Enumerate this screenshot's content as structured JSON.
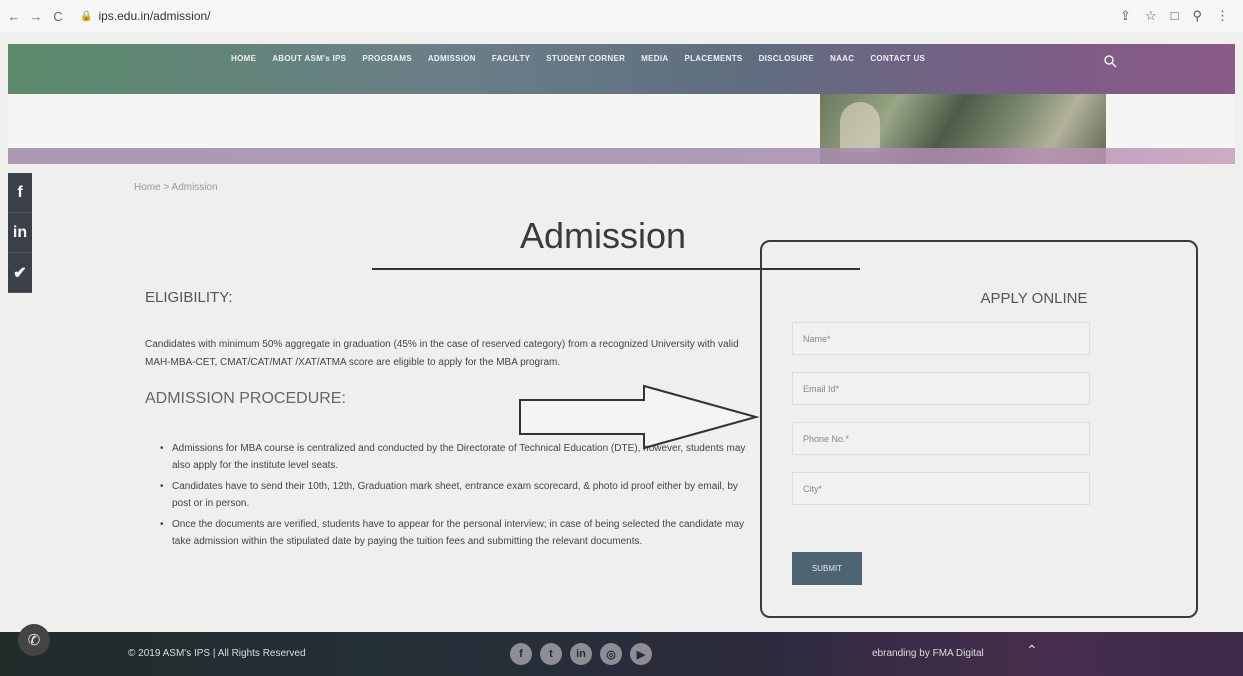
{
  "browser": {
    "back_icon": "←",
    "forward_icon": "→",
    "reload_icon": "C",
    "url": "ips.edu.in/admission/",
    "right_icons": [
      "⇪",
      "☆",
      "□",
      "⚲",
      "⋮"
    ]
  },
  "nav": {
    "items": [
      "HOME",
      "ABOUT ASM's IPS",
      "PROGRAMS",
      "ADMISSION",
      "FACULTY",
      "STUDENT CORNER",
      "MEDIA",
      "PLACEMENTS",
      "DISCLOSURE",
      "NAAC",
      "CONTACT US"
    ]
  },
  "social": [
    "f",
    "in",
    "✔"
  ],
  "breadcrumb": "Home  >  Admission",
  "page": {
    "title": "Admission",
    "eligibility_heading": "ELIGIBILITY:",
    "eligibility_text": "Candidates with minimum 50% aggregate in graduation (45% in the case of reserved category) from a recognized University with valid MAH-MBA-CET, CMAT/CAT/MAT /XAT/ATMA score are eligible to apply for the MBA program.",
    "procedure_heading": "ADMISSION PROCEDURE:",
    "procedure_items": [
      "Admissions for MBA course is centralized and conducted by the Directorate of Technical Education (DTE), however, students may also apply for the institute level seats.",
      "Candidates have to send their 10th, 12th, Graduation mark sheet, entrance exam scorecard, & photo id proof either by email, by post or in person.",
      "Once the documents are verified, students have to appear for the personal interview; in case of being selected the candidate may take admission within the stipulated date by paying the tuition fees and submitting the relevant documents."
    ]
  },
  "apply": {
    "title": "APPLY ONLINE",
    "name_placeholder": "Name*",
    "email_placeholder": "Email Id*",
    "phone_placeholder": "Phone No.*",
    "city_placeholder": "City*",
    "submit_label": "SUBMIT"
  },
  "footer": {
    "copyright": "© 2019 ASM's IPS | All Rights Reserved",
    "branding": "ebranding by FMA Digital",
    "social_icons": [
      "f",
      "t",
      "in",
      "◎",
      "▶"
    ],
    "up_icon": "⌃",
    "whatsapp_icon": "✆"
  }
}
